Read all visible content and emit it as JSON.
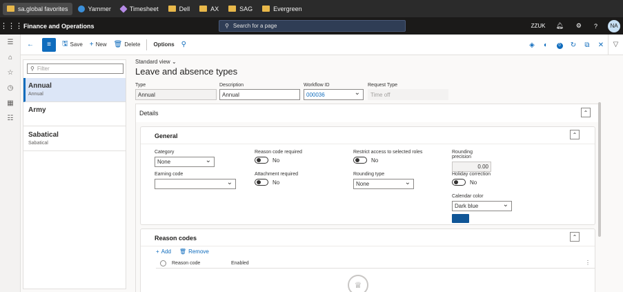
{
  "favorites": [
    {
      "label": "sa.global favorites",
      "icon": "folder-icon"
    },
    {
      "label": "Yammer",
      "icon": "yammer-icon"
    },
    {
      "label": "Timesheet",
      "icon": "timesheet-icon"
    },
    {
      "label": "Dell",
      "icon": "folder-icon"
    },
    {
      "label": "AX",
      "icon": "folder-icon"
    },
    {
      "label": "SAG",
      "icon": "folder-icon"
    },
    {
      "label": "Evergreen",
      "icon": "folder-icon"
    }
  ],
  "app": {
    "title": "Finance and Operations",
    "search_placeholder": "Search for a page",
    "company": "ZZUK",
    "avatar": "NA"
  },
  "actions": {
    "save": "Save",
    "new": "New",
    "delete": "Delete",
    "options": "Options",
    "badge": "0"
  },
  "list": {
    "filter_placeholder": "Filter",
    "items": [
      {
        "title": "Annual",
        "subtitle": "Annual"
      },
      {
        "title": "Army",
        "subtitle": ""
      },
      {
        "title": "Sabatical",
        "subtitle": "Sabatical"
      }
    ]
  },
  "page": {
    "view": "Standard view",
    "title": "Leave and absence types"
  },
  "header_fields": {
    "type_label": "Type",
    "type_value": "Annual",
    "description_label": "Description",
    "description_value": "Annual",
    "workflow_label": "Workflow ID",
    "workflow_value": "000036",
    "request_type_label": "Request Type",
    "request_type_value": "Time off"
  },
  "details": {
    "title": "Details",
    "general": {
      "title": "General",
      "category_label": "Category",
      "category_value": "None",
      "earning_code_label": "Earning code",
      "earning_code_value": "",
      "reason_code_required_label": "Reason code required",
      "reason_code_required_value": "No",
      "attachment_required_label": "Attachment required",
      "attachment_required_value": "No",
      "restrict_access_label": "Restrict access to selected roles",
      "restrict_access_value": "No",
      "rounding_type_label": "Rounding type",
      "rounding_type_value": "None",
      "rounding_precision_label": "Rounding precision",
      "rounding_precision_value": "0.00",
      "holiday_correction_label": "Holiday correction",
      "holiday_correction_value": "No",
      "calendar_color_label": "Calendar color",
      "calendar_color_value": "Dark blue",
      "calendar_color_hex": "#0f5596"
    },
    "reason_codes": {
      "title": "Reason codes",
      "add": "Add",
      "remove": "Remove",
      "col_reason_code": "Reason code",
      "col_enabled": "Enabled"
    }
  },
  "colors": {
    "accent": "#0f6cbd",
    "header": "#1b1a19"
  }
}
